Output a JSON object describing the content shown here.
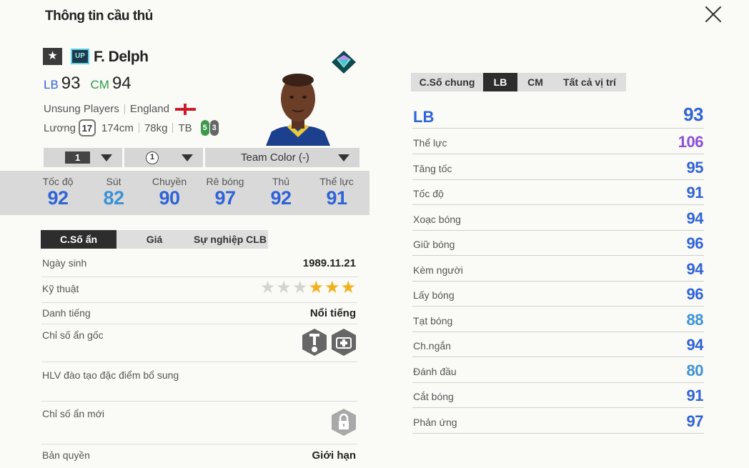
{
  "page_title": "Thông tin cầu thủ",
  "player": {
    "name": "F. Delph",
    "season_badge": "UP",
    "positions": [
      {
        "pos": "LB",
        "ovr": "93"
      },
      {
        "pos": "CM",
        "ovr": "94"
      }
    ],
    "team": "Unsung Players",
    "nation": "England",
    "salary_label": "Lương",
    "salary": "17",
    "height": "174cm",
    "weight": "78kg",
    "build": "TB",
    "left_foot": "5",
    "right_foot": "3"
  },
  "selectors": {
    "upgrade": "1",
    "team_color_level": "1",
    "team_color": "Team Color (-)"
  },
  "stats": [
    {
      "label": "Tốc độ",
      "value": "92",
      "color": "#2f63d6"
    },
    {
      "label": "Sút",
      "value": "82",
      "color": "#3b93d6"
    },
    {
      "label": "Chuyền",
      "value": "90",
      "color": "#2f63d6"
    },
    {
      "label": "Rê bóng",
      "value": "97",
      "color": "#2f63d6"
    },
    {
      "label": "Thủ",
      "value": "92",
      "color": "#2f63d6"
    },
    {
      "label": "Thể lực",
      "value": "91",
      "color": "#2f63d6"
    }
  ],
  "left_tabs": [
    "C.Số ẩn",
    "Giá",
    "Sự nghiệp CLB"
  ],
  "details": {
    "birth_label": "Ngày sinh",
    "birth": "1989.11.21",
    "skill_label": "Kỹ thuật",
    "skill_stars": 3,
    "skill_max": 6,
    "reputation_label": "Danh tiếng",
    "reputation": "Nổi tiếng",
    "traits_label": "Chỉ số ẩn gốc",
    "traits_icons": [
      "long-throw-icon",
      "injury-prone-icon"
    ],
    "coach_label": "HLV đào tạo đặc điểm bổ sung",
    "new_traits_label": "Chỉ số ẩn mới",
    "license_label": "Bản quyền",
    "license": "Giới hạn"
  },
  "right_tabs": [
    "C.Số chung",
    "LB",
    "CM",
    "Tất cả vị trí"
  ],
  "right_active": 1,
  "position_head": {
    "label": "LB",
    "value": "93"
  },
  "attributes": [
    {
      "label": "Thể lực",
      "value": "106",
      "color": "#8a4fd6"
    },
    {
      "label": "Tăng tốc",
      "value": "95",
      "color": "#2f63d6"
    },
    {
      "label": "Tốc độ",
      "value": "91",
      "color": "#2f63d6"
    },
    {
      "label": "Xoạc bóng",
      "value": "94",
      "color": "#2f63d6"
    },
    {
      "label": "Giữ bóng",
      "value": "96",
      "color": "#2f63d6"
    },
    {
      "label": "Kèm người",
      "value": "94",
      "color": "#2f63d6"
    },
    {
      "label": "Lấy bóng",
      "value": "96",
      "color": "#2f63d6"
    },
    {
      "label": "Tạt bóng",
      "value": "88",
      "color": "#3b93d6"
    },
    {
      "label": "Ch.ngắn",
      "value": "94",
      "color": "#2f63d6"
    },
    {
      "label": "Đánh đầu",
      "value": "80",
      "color": "#3b93d6"
    },
    {
      "label": "Cắt bóng",
      "value": "91",
      "color": "#2f63d6"
    },
    {
      "label": "Phản ứng",
      "value": "97",
      "color": "#2f63d6"
    }
  ]
}
